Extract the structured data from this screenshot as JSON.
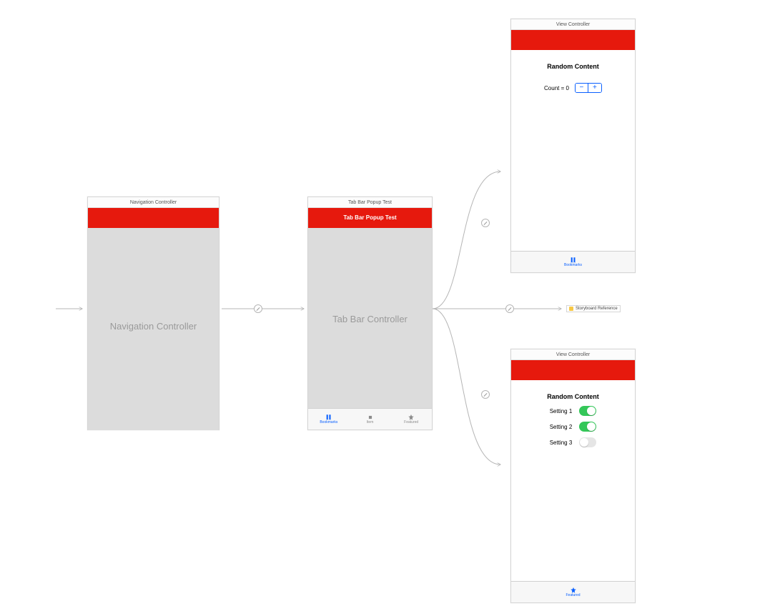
{
  "scenes": {
    "nav_controller": {
      "title": "Navigation Controller",
      "body_label": "Navigation Controller"
    },
    "tabbar_controller": {
      "title": "Tab Bar Popup Test",
      "nav_title": "Tab Bar Popup Test",
      "body_label": "Tab Bar Controller",
      "tabs": [
        {
          "label": "Bookmarks",
          "active": true,
          "icon": "bookmarks"
        },
        {
          "label": "Item",
          "active": false,
          "icon": "square"
        },
        {
          "label": "Featured",
          "active": false,
          "icon": "star"
        }
      ]
    },
    "vc_top": {
      "title": "View Controller",
      "heading": "Random Content",
      "count_label": "Count = 0",
      "tab": {
        "label": "Bookmarks",
        "icon": "bookmarks"
      }
    },
    "storyboard_ref": {
      "label": "Storyboard Reference"
    },
    "vc_bottom": {
      "title": "View Controller",
      "heading": "Random Content",
      "settings": [
        {
          "label": "Setting 1",
          "on": true
        },
        {
          "label": "Setting 2",
          "on": true
        },
        {
          "label": "Setting 3",
          "on": false
        }
      ],
      "tab": {
        "label": "Featured",
        "icon": "star"
      }
    }
  },
  "stepper": {
    "minus": "−",
    "plus": "+"
  }
}
